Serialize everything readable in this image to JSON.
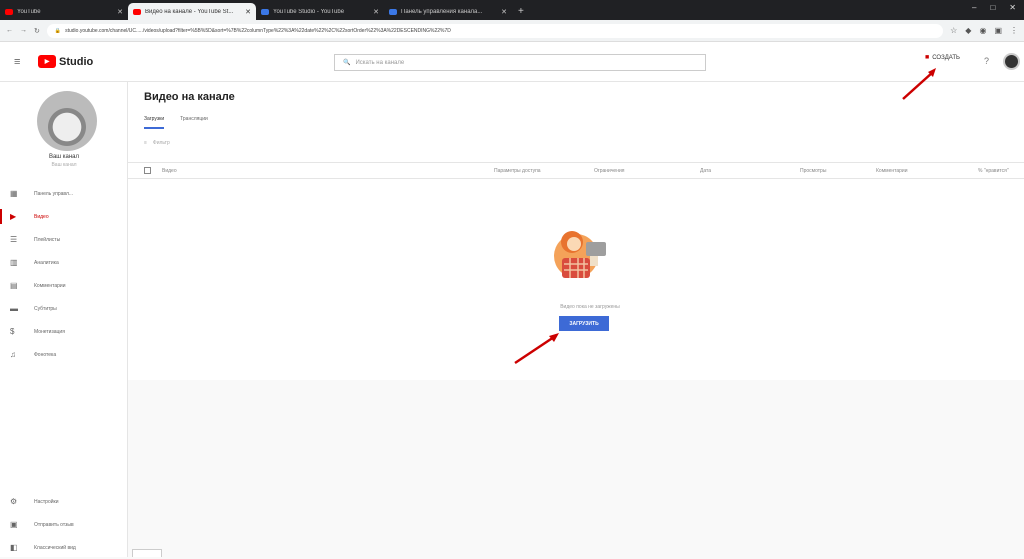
{
  "browser": {
    "tabs": [
      {
        "title": "YouTube"
      },
      {
        "title": "Видео на канале - YouTube St...",
        "active": true
      },
      {
        "title": "YouTube Studio - YouTube"
      },
      {
        "title": "Панель управления канала..."
      }
    ],
    "new_tab": "+",
    "window_controls": [
      "–",
      "□",
      "✕"
    ],
    "url": "studio.youtube.com/channel/UC...../videos/upload?filter=%5B%5D&sort=%7B%22columnType%22%3A%22date%22%2C%22sortOrder%22%3A%22DESCENDING%22%7D"
  },
  "header": {
    "logo_text": "Studio",
    "search_placeholder": "Искать на канале",
    "create_label": "СОЗДАТЬ"
  },
  "channel": {
    "name": "Ваш канал",
    "subtitle": "Ваш канал"
  },
  "sidebar": {
    "items": [
      {
        "label": "Панель управл...",
        "icon": "dashboard-icon"
      },
      {
        "label": "Видео",
        "icon": "video-icon",
        "active": true
      },
      {
        "label": "Плейлисты",
        "icon": "playlist-icon"
      },
      {
        "label": "Аналитика",
        "icon": "analytics-icon"
      },
      {
        "label": "Комментарии",
        "icon": "comments-icon"
      },
      {
        "label": "Субтитры",
        "icon": "subtitles-icon"
      },
      {
        "label": "Монетизация",
        "icon": "monetization-icon"
      },
      {
        "label": "Фонотека",
        "icon": "audio-library-icon"
      }
    ],
    "bottom_items": [
      {
        "label": "Настройки",
        "icon": "settings-icon"
      },
      {
        "label": "Отправить отзыв",
        "icon": "feedback-icon"
      },
      {
        "label": "Классический вид",
        "icon": "classic-icon"
      }
    ]
  },
  "main": {
    "title": "Видео на канале",
    "tabs": [
      "Загрузки",
      "Трансляции"
    ],
    "filter_label": "Фильтр",
    "columns": [
      "Видео",
      "Параметры доступа",
      "Ограничения",
      "Дата",
      "Просмотры",
      "Комментарии",
      "% \"нравится\""
    ],
    "empty_text": "Видео пока не загружены",
    "upload_button": "ЗАГРУЗИТЬ"
  },
  "colors": {
    "accent": "#3d6ad6",
    "youtube_red": "#ff0000",
    "arrow": "#cc0000"
  }
}
